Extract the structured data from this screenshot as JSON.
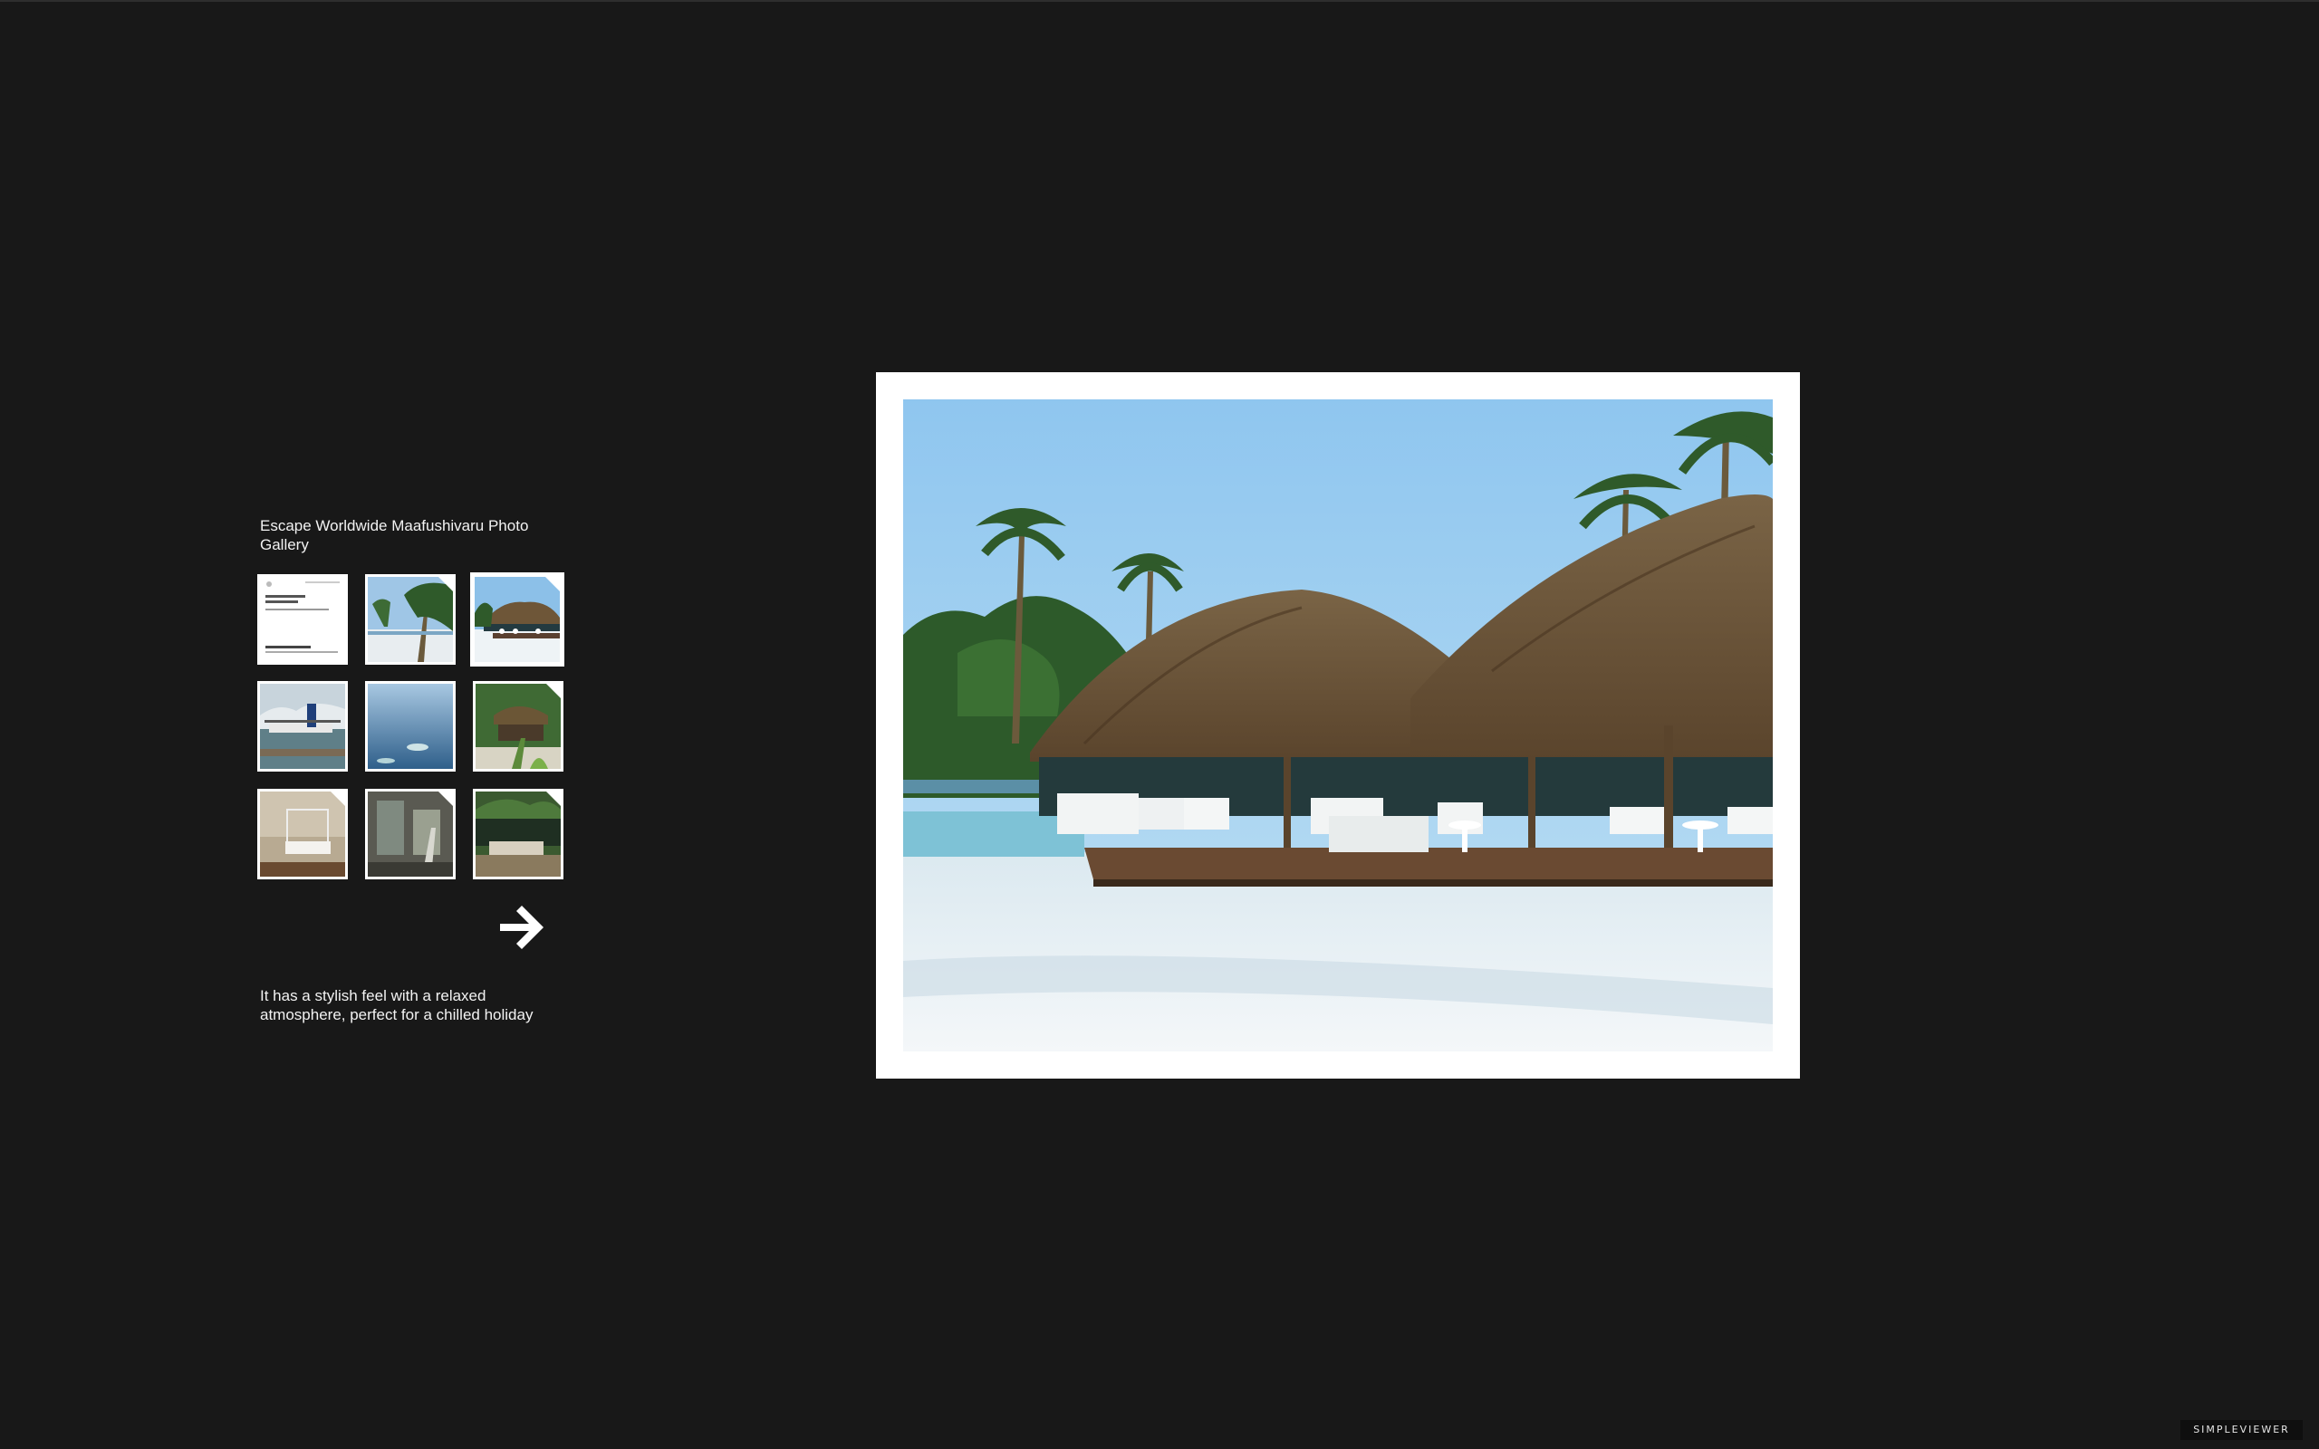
{
  "gallery": {
    "title": "Escape Worldwide Maafushivaru Photo Gallery",
    "selected_index": 2,
    "caption": "It has a stylish feel with a relaxed atmosphere, perfect for a chilled holiday",
    "next_icon": "arrow-right-icon",
    "thumbnails": [
      {
        "name": "document-page",
        "icon": "document-thumbnail"
      },
      {
        "name": "beach-palms",
        "icon": "photo-thumbnail"
      },
      {
        "name": "beach-bar",
        "icon": "photo-thumbnail"
      },
      {
        "name": "seaplane",
        "icon": "photo-thumbnail"
      },
      {
        "name": "aerial-atoll",
        "icon": "photo-thumbnail"
      },
      {
        "name": "villa-garden",
        "icon": "photo-thumbnail"
      },
      {
        "name": "bedroom",
        "icon": "photo-thumbnail"
      },
      {
        "name": "bathroom",
        "icon": "photo-thumbnail"
      },
      {
        "name": "beach-villa",
        "icon": "photo-thumbnail"
      }
    ]
  },
  "branding": {
    "logo_text": "SIMPLEVIEWER"
  },
  "colors": {
    "background": "#181818",
    "frame": "#ffffff",
    "text": "#f2f2f2"
  }
}
